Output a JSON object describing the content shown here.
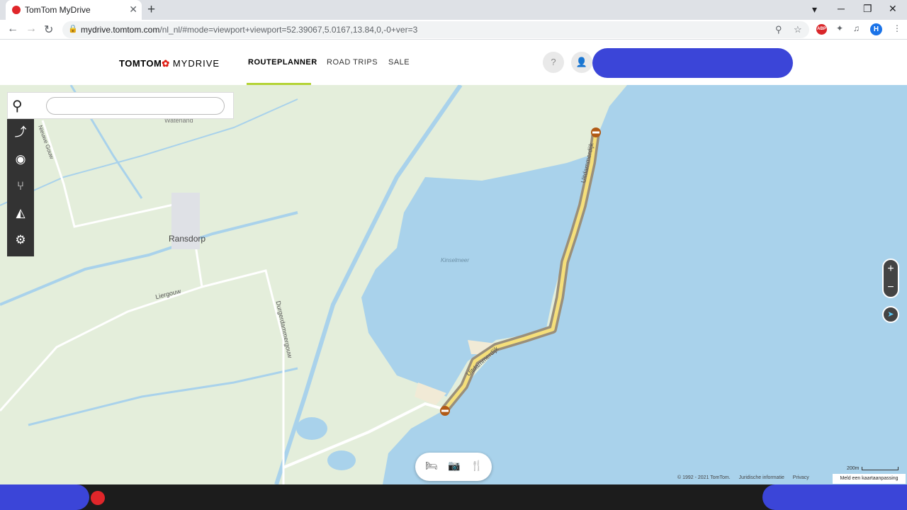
{
  "browser": {
    "tab_title": "TomTom MyDrive",
    "tab_close": "✕",
    "new_tab": "+",
    "url_host": "mydrive.tomtom.com",
    "url_rest": "/nl_nl/#mode=viewport+viewport=52.39067,5.0167,13.84,0,-0+ver=3",
    "profile_initial": "H",
    "abp_label": "ABP",
    "icons": [
      "back-icon",
      "forward-icon",
      "reload-icon",
      "lock-icon",
      "location-icon",
      "star-icon",
      "puzzle-icon",
      "media-icon",
      "menu-icon"
    ]
  },
  "header": {
    "logo_main": "TOMTOM",
    "logo_sub": "MYDRIVE",
    "nav": [
      "ROUTEPLANNER",
      "ROAD TRIPS",
      "SALE"
    ],
    "active_nav": "ROUTEPLANNER",
    "help_glyph": "?",
    "user_glyph": "👤",
    "accent_color": "#b4d335"
  },
  "search": {
    "placeholder": "",
    "value": ""
  },
  "map": {
    "places": {
      "ransdorp": "Ransdorp",
      "waterland": "Waterland",
      "kinselmeer": "Kinselmeer"
    },
    "roads": {
      "nieuwe_gouw": "Nieuwe Gouw",
      "liergouw": "Liergouw",
      "durgerdammergouw": "Durgerdammergouw",
      "uitdammerdijk_north": "Uitdammerdijk",
      "uitdammerdijk_south": "Uitdammerdijk"
    },
    "water_color": "#a9d2eb",
    "land_color": "#e4eedb",
    "route_color": "#f5df7a"
  },
  "controls": {
    "zoom_in": "+",
    "zoom_out": "−",
    "locate": "➤"
  },
  "footer": {
    "copyright": "© 1992 - 2021 TomTom.",
    "legal": "Juridische informatie",
    "privacy": "Privacy",
    "report": "Meld een kaartaanpassing",
    "scale": "200m"
  }
}
